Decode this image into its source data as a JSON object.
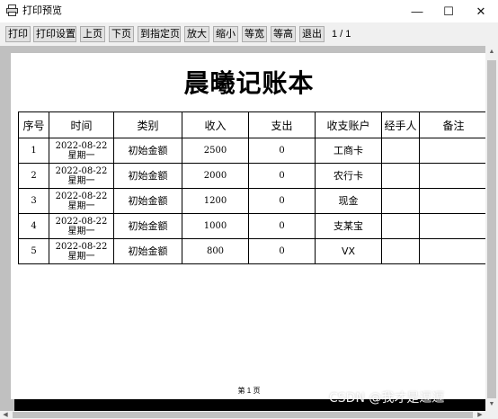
{
  "window": {
    "title": "打印预览",
    "icon": "print-preview-icon",
    "controls": {
      "minimize": "—",
      "maximize": "☐",
      "close": "✕"
    }
  },
  "toolbar": {
    "print": "打印",
    "print_setup": "打印设置",
    "prev_page": "上页",
    "next_page": "下页",
    "goto_page": "到指定页",
    "zoom_in": "放大",
    "zoom_out": "缩小",
    "fit_width": "等宽",
    "fit_height": "等高",
    "exit": "退出",
    "page_indicator": "1 / 1"
  },
  "document": {
    "title": "晨曦记账本",
    "columns": [
      "序号",
      "时间",
      "类别",
      "收入",
      "支出",
      "收支账户",
      "经手人",
      "备注"
    ],
    "rows": [
      {
        "index": "1",
        "date": "2022-08-22",
        "weekday": "星期一",
        "category": "初始金额",
        "income": "2500",
        "expense": "0",
        "account": "工商卡",
        "handler": "",
        "note": ""
      },
      {
        "index": "2",
        "date": "2022-08-22",
        "weekday": "星期一",
        "category": "初始金额",
        "income": "2000",
        "expense": "0",
        "account": "农行卡",
        "handler": "",
        "note": ""
      },
      {
        "index": "3",
        "date": "2022-08-22",
        "weekday": "星期一",
        "category": "初始金额",
        "income": "1200",
        "expense": "0",
        "account": "现金",
        "handler": "",
        "note": ""
      },
      {
        "index": "4",
        "date": "2022-08-22",
        "weekday": "星期一",
        "category": "初始金额",
        "income": "1000",
        "expense": "0",
        "account": "支某宝",
        "handler": "",
        "note": ""
      },
      {
        "index": "5",
        "date": "2022-08-22",
        "weekday": "星期一",
        "category": "初始金额",
        "income": "800",
        "expense": "0",
        "account": "VX",
        "handler": "",
        "note": ""
      }
    ],
    "footer": "第 1 页"
  },
  "watermark": "CSDN @我才是逗逗"
}
